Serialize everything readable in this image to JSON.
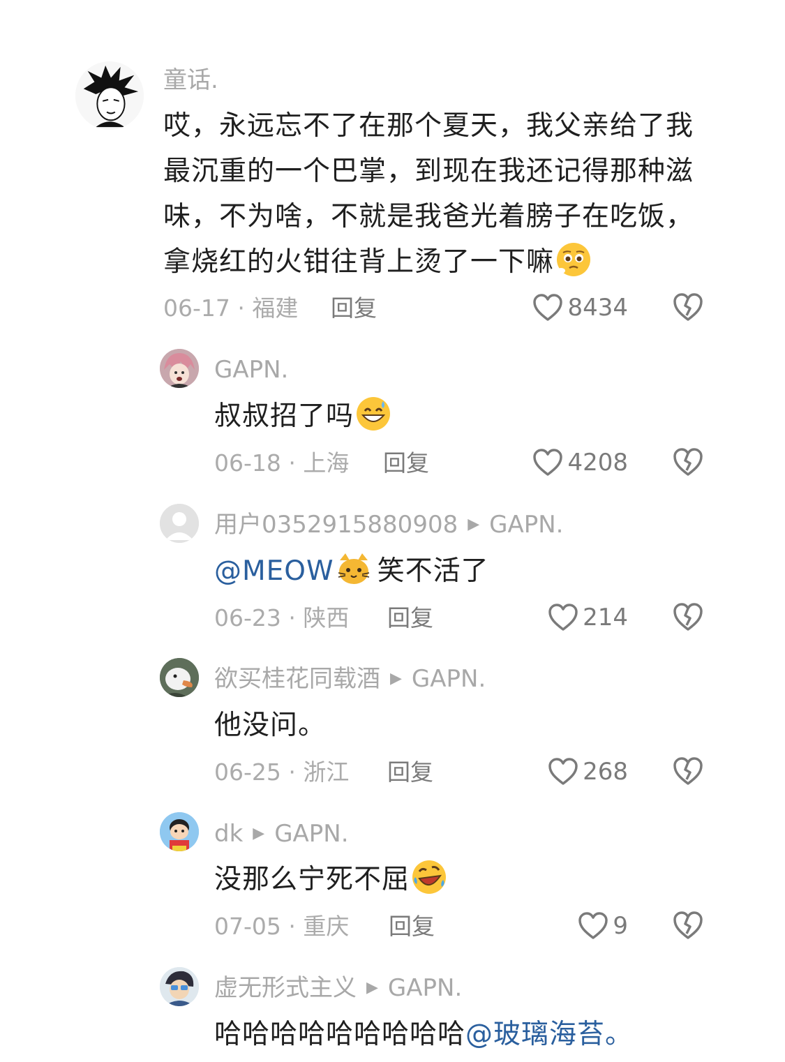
{
  "comments": [
    {
      "username": "童话.",
      "text_lines": [
        "哎，永远忘不了在那个夏天，我父亲给了我",
        "最沉重的一个巴掌，到现在我还记得那种滋",
        "味，不为啥，不就是我爸光着膀子在吃饭，",
        "拿烧红的火钳往背上烫了一下嘛"
      ],
      "meta": "06-17 · 福建",
      "reply": "回复",
      "likes": "8434"
    },
    {
      "username": "GAPN.",
      "text": "叔叔招了吗",
      "meta": "06-18 · 上海",
      "reply": "回复",
      "likes": "4208"
    },
    {
      "username": "用户0352915880908",
      "reply_to": "GAPN.",
      "mention": "@MEOW",
      "text": "笑不活了",
      "meta": "06-23 · 陕西",
      "reply": "回复",
      "likes": "214"
    },
    {
      "username": "欲买桂花同载酒",
      "reply_to": "GAPN.",
      "text": "他没问。",
      "meta": "06-25 · 浙江",
      "reply": "回复",
      "likes": "268"
    },
    {
      "username": "dk",
      "reply_to": "GAPN.",
      "text": "没那么宁死不屈",
      "meta": "07-05 · 重庆",
      "reply": "回复",
      "likes": "9"
    },
    {
      "username": "虚无形式主义",
      "reply_to": "GAPN.",
      "text": "哈哈哈哈哈哈哈哈哈",
      "mention": "@玻璃海苔。"
    }
  ],
  "icons": {
    "like": "heart-outline-icon",
    "dislike": "broken-heart-icon",
    "reply_arrow": "triangle-right-icon"
  },
  "colors": {
    "text": "#1f1f1f",
    "meta": "#ababab",
    "mention": "#2a5f9e",
    "action": "#7a7a7a"
  }
}
